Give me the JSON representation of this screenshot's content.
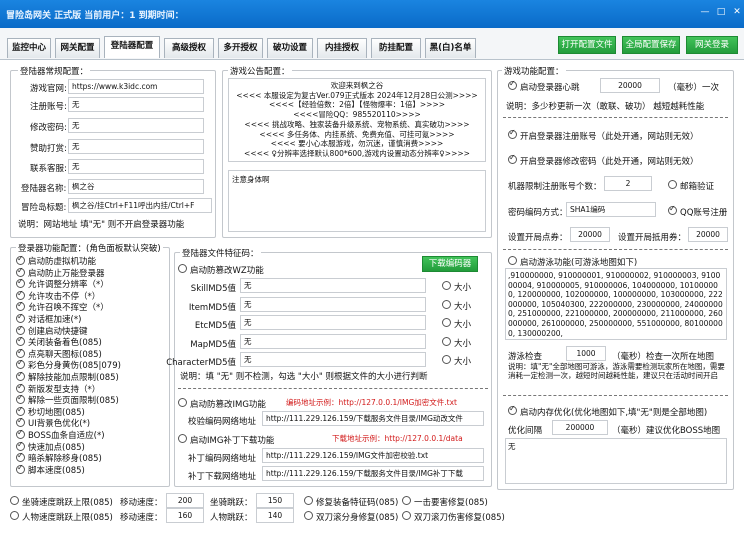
{
  "title": "冒险岛网关 正式版    当前用户：1  到期时间：",
  "window": {
    "min": "—",
    "max": "□",
    "close": "✕"
  },
  "tabs": [
    "监控中心",
    "网关配置",
    "登陆器配置",
    "高级授权",
    "多开授权",
    "破功设置",
    "内挂授权",
    "防挂配置",
    "黑(白)名单"
  ],
  "buttons": {
    "open_config": "打开配置文件",
    "save_config": "全局配置保存",
    "login": "网关登录"
  },
  "basic": {
    "title": "登陆器常规配置：",
    "fields": [
      {
        "label": "游戏官网:",
        "value": "https://www.k3idc.com"
      },
      {
        "label": "注册账号:",
        "value": "无"
      },
      {
        "label": "修改密码:",
        "value": "无"
      },
      {
        "label": "赞助打赏:",
        "value": "无"
      },
      {
        "label": "联系客服:",
        "value": "无"
      },
      {
        "label": "登陆器名称:",
        "value": "枫之谷"
      },
      {
        "label": "冒险岛标题:",
        "value": "枫之谷/挂Ctrl+F11呼出内挂/Ctrl+F"
      }
    ],
    "note": "说明：网站地址 填\"无\" 则不开启登录器功能"
  },
  "announce": {
    "title": "游戏公告配置：",
    "lines": [
      "欢迎来到枫之谷",
      "<<<< 本服设定为复古Ver.079正式版本 2024年12月28日公测>>>>",
      "<<<<【经验倍数：2倍】【怪物爆率：1倍】>>>>",
      "<<<<冒险QQ：985520110>>>>",
      "<<<< 挑战攻略、独家装备升级系统、宠物系统、真实破功>>>>",
      "<<<< 多任务体、内挂系统、免费充值、可挂可氪>>>>",
      "<<<< 要小心本服游戏，勿沉迷，谨慎消费>>>>",
      "<<<< ♀分辨率选择默认800*600,游戏内设置动态分辨率♀>>>>"
    ],
    "notice_label": "注意身体啊"
  },
  "func": {
    "title": "游戏功能配置：",
    "heartbeat_label": "启动登录器心跳",
    "heartbeat_value": "20000",
    "heartbeat_unit": "（毫秒）一次",
    "heartbeat_desc": "说明：多少秒更新一次（敢联、破功） 越短越耗性能",
    "reg_limit": "开启登录器注册账号（此处开通，网站则无效）",
    "pwd_limit": "开启登录器修改密码（此处开通，网站则无效）",
    "machine_label": "机器限制注册账号个数：",
    "machine_value": "2",
    "mail_verify": "邮箱验证",
    "pwd_mode_label": "密码编码方式：",
    "pwd_mode_value": "SHA1编码",
    "qq_reg": "QQ账号注册",
    "open_points_label": "设置开局点券：",
    "open_points_value": "20000",
    "open_mile_label": "设置开局抵用券：",
    "open_mile_value": "20000",
    "anti_map": "启动游泳功能(可游泳地图如下)",
    "map_list": ",910000000, 910000001, 910000002, 910000003, 910000004, 910000005, 910000006, 104000000, 101000000, 120000000, 102000000, 100000000, 103000000, 222000000, 105040300, 222000000, 230000000, 240000000, 251000000, 221000000, 200000000, 211000000, 260000000, 261000000, 250000000, 551000000, 801000000, 130000200,",
    "swim_label": "游泳检查",
    "swim_value": "1000",
    "swim_unit": "（毫秒）检查一次所在地图",
    "swim_desc": "说明：填\"无\"全部地图可游泳，游泳需要检测玩家所在地图，需要消耗一定检测一次，越短时间越耗性能，建议只在活动时间开启",
    "opt_map": "启动内存优化(优化地图如下,填\"无\"则是全部地图)",
    "opt_label": "优化间隔",
    "opt_value": "200000",
    "opt_unit": "（毫秒）建议优化BOSS地图",
    "opt_text": "无"
  },
  "login": {
    "title": "登录器功能配置：(角色面板默认突破)",
    "items": [
      "启动防虚拟机功能",
      "启动防止万能登录器",
      "允许调整分辨率（*）",
      "允许攻击不停（*）",
      "允许召唤不挥空（*）",
      "对话框加速(*)",
      "创建启动快捷键",
      "关闭装备着色(085)",
      "点亮聊天图标(085)",
      "彩色分身黄伤(085|079)",
      "解除技能加点限制(085)",
      "新版发型支持（*）",
      "解除一些页面限制(085)",
      "秒切地图(085)",
      "UI背景色优化(*)",
      "BOSS血条自适应(*)",
      "快速加点(085)",
      "暗杀解除移身(085)",
      "脚本速度(085)"
    ]
  },
  "files": {
    "title": "登陆器文件特征码：",
    "wz_label": "启动防篡改WZ功能",
    "download_btn": "下载编码器",
    "rows": [
      {
        "label": "SkillMD5值",
        "value": "无",
        "size": "大小"
      },
      {
        "label": "ItemMD5值",
        "value": "无",
        "size": "大小"
      },
      {
        "label": "EtcMD5值",
        "value": "无",
        "size": "大小"
      },
      {
        "label": "MapMD5值",
        "value": "无",
        "size": "大小"
      },
      {
        "label": "CharacterMD5值",
        "value": "无",
        "size": "大小"
      }
    ],
    "note": "说明：填 \"无\" 则不检测，勾选 \"大小\" 则根据文件的大小进行判断",
    "img_check": "启动防篡改IMG功能",
    "img_example": "编码地址示例：http://127.0.0.1/IMG加密文件.txt",
    "verify_label": "校验编码网络地址",
    "verify_value": "http://111.229.126.159/下载服务文件目录/IMG动改文件",
    "patch_label": "启动IMG补丁下载功能",
    "patch_example": "下载地址示例：http://127.0.0.1/data",
    "patch_code_label": "补丁编码网络地址",
    "patch_code_value": "http://111.229.126.159/IMG文件加密校验.txt",
    "patch_dl_label": "补丁下载网络地址",
    "patch_dl_value": "http://111.229.126.159/下载服务文件目录/IMG补丁下载"
  },
  "bottom": {
    "r1": "坐骑速度跳跃上限(085)",
    "r2": "人物速度跳跃上限(085)",
    "move1": "移动速度：",
    "move1_v": "200",
    "jump1": "坐骑跳跃：",
    "jump1_v": "150",
    "move2": "移动速度：",
    "move2_v": "160",
    "jump2": "人物跳跃：",
    "jump2_v": "140",
    "c1": "修复装备特征码(085)",
    "c2": "一击要害修复(085)",
    "c3": "双刀滚分身修复(085)",
    "c4": "双刀滚刀伤害修复(085)"
  }
}
